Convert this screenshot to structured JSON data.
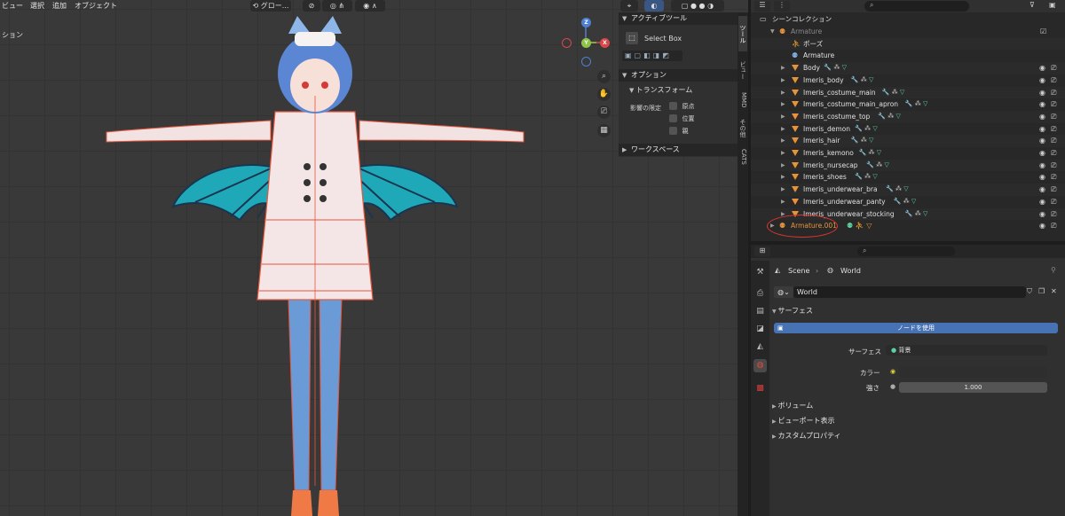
{
  "viewport": {
    "menus": [
      "ビュー",
      "選択",
      "追加",
      "オブジェクト"
    ],
    "side_label": "ション",
    "transform_orientation": "グロー...",
    "gizmo": {
      "z": "Z",
      "y": "Y",
      "x": "X"
    }
  },
  "npanel": {
    "active_tool_header": "アクティブツール",
    "tool_name": "Select Box",
    "options_header": "オプション",
    "transform_header": "トランスフォーム",
    "affect_only_label": "影響の限定",
    "checkboxes": [
      "原点",
      "位置",
      "親"
    ],
    "workspace_header": "ワークスペース",
    "tabs": [
      "ツール",
      "ビュー",
      "MMD",
      "その他",
      "CATS"
    ]
  },
  "outliner": {
    "collection": "シーンコレクション",
    "rows": [
      {
        "name": "Armature",
        "level": 1,
        "kind": "armature",
        "dim": true
      },
      {
        "name": "ポーズ",
        "level": 2,
        "kind": "pose"
      },
      {
        "name": "Armature",
        "level": 2,
        "kind": "armature-data"
      },
      {
        "name": "Body",
        "level": 2,
        "kind": "mesh"
      },
      {
        "name": "Imeris_body",
        "level": 2,
        "kind": "mesh"
      },
      {
        "name": "Imeris_costume_main",
        "level": 2,
        "kind": "mesh"
      },
      {
        "name": "Imeris_costume_main_apron",
        "level": 2,
        "kind": "mesh"
      },
      {
        "name": "Imeris_costume_top",
        "level": 2,
        "kind": "mesh"
      },
      {
        "name": "Imeris_demon",
        "level": 2,
        "kind": "mesh"
      },
      {
        "name": "Imeris_hair",
        "level": 2,
        "kind": "mesh"
      },
      {
        "name": "Imeris_kemono",
        "level": 2,
        "kind": "mesh"
      },
      {
        "name": "Imeris_nursecap",
        "level": 2,
        "kind": "mesh"
      },
      {
        "name": "Imeris_shoes",
        "level": 2,
        "kind": "mesh"
      },
      {
        "name": "Imeris_underwear_bra",
        "level": 2,
        "kind": "mesh"
      },
      {
        "name": "Imeris_underwear_panty",
        "level": 2,
        "kind": "mesh"
      },
      {
        "name": "Imeris_underwear_stocking",
        "level": 2,
        "kind": "mesh"
      },
      {
        "name": "Armature.001",
        "level": 1,
        "kind": "armature",
        "highlight": true
      }
    ]
  },
  "properties": {
    "breadcrumb_scene": "Scene",
    "breadcrumb_world": "World",
    "world_name": "World",
    "surface_header": "サーフェス",
    "use_nodes_button": "ノードを使用",
    "surface_label": "サーフェス",
    "surface_value": "背景",
    "color_label": "カラー",
    "strength_label": "強さ",
    "strength_value": "1.000",
    "sections": [
      "ボリューム",
      "ビューポート表示",
      "カスタムプロパティ"
    ]
  },
  "colors": {
    "accent_blue": "#4772b3",
    "highlight_red": "#e0352b",
    "object_orange": "#e8933a",
    "mesh_green": "#5bd2a0"
  }
}
